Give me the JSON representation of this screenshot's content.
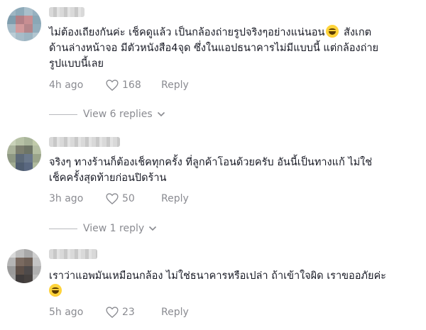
{
  "comments": [
    {
      "lines": [
        "ไม่ต้องเถียงกันค่ะ เช็คดูแล้ว เป็นกล้องถ่ายรูปจริงๆอย่างแน่นอน",
        " สังเกต",
        "ด้านล่างหน้าจอ มีตัวหนังสือ4จุด ซึ่งในแอปธนาคารไม่มีแบบนี้ แต่กล้องถ่าย",
        "รูปแบบนี้เลย"
      ],
      "time": "4h ago",
      "likes": "168",
      "reply_label": "Reply",
      "view_replies": "View 6 replies",
      "emoji": "grinning-sweat-emoji"
    },
    {
      "lines": [
        "จริงๆ ทางร้านก็ต้องเช็คทุกครั้ง ที่ลูกค้าโอนด้วยครับ อันนี้เป็นทางแก้ ไม่ใช่",
        "เช็คครั้งสุดท้ายก่อนปิดร้าน"
      ],
      "time": "3h ago",
      "likes": "50",
      "reply_label": "Reply",
      "view_replies": "View 1 reply"
    },
    {
      "lines": [
        "เราว่าแอพมันเหมือนกล้อง ไม่ใช่ธนาคารหรือเปล่า ถ้าเข้าใจผิด เราขออภัยค่ะ"
      ],
      "time": "5h ago",
      "likes": "23",
      "reply_label": "Reply",
      "emoji": "grinning-sweat-emoji"
    }
  ],
  "colors": {
    "text": "#161823",
    "meta": "#8a8b91"
  },
  "icons": {
    "like": "heart-outline-icon",
    "expand": "chevron-down-icon"
  }
}
